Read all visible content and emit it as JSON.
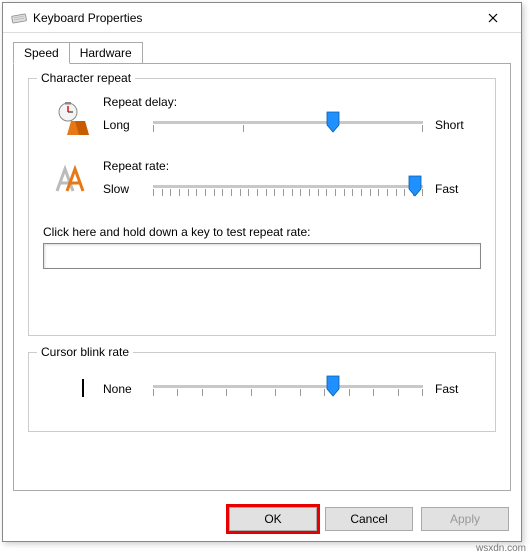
{
  "window": {
    "title": "Keyboard Properties"
  },
  "tabs": {
    "speed": "Speed",
    "hardware": "Hardware"
  },
  "char_repeat": {
    "legend": "Character repeat",
    "repeat_delay_label": "Repeat delay:",
    "repeat_delay_left": "Long",
    "repeat_delay_right": "Short",
    "repeat_delay_pos_percent": 64,
    "repeat_rate_label": "Repeat rate:",
    "repeat_rate_left": "Slow",
    "repeat_rate_right": "Fast",
    "repeat_rate_pos_percent": 98,
    "test_label": "Click here and hold down a key to test repeat rate:",
    "test_value": ""
  },
  "cursor_blink": {
    "legend": "Cursor blink rate",
    "left": "None",
    "right": "Fast",
    "pos_percent": 64
  },
  "buttons": {
    "ok": "OK",
    "cancel": "Cancel",
    "apply": "Apply"
  },
  "watermark": "wsxdn.com"
}
